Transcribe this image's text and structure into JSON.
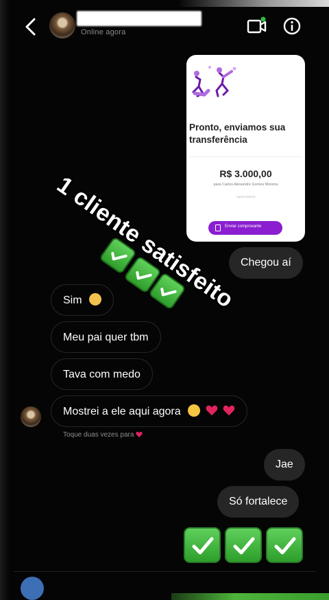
{
  "header": {
    "status": "Online agora",
    "icons": {
      "back": "chevron-left-icon",
      "video": "video-call-icon",
      "info": "info-icon"
    }
  },
  "card": {
    "title": "Pronto, enviamos sua transferência",
    "amount": "R$ 3.000,00",
    "recipient": "para Carlos Alexandre Gomes Moreira",
    "date": "Agora mesmo",
    "button_label": "Enviar comprovante",
    "accent": "#8a1ed0"
  },
  "sticker": {
    "text": "1 cliente satisfeito"
  },
  "messages": [
    {
      "id": "chegou",
      "side": "out",
      "text": "Chegou aí"
    },
    {
      "id": "sim",
      "side": "in",
      "text": "Sim",
      "emoji": "clapping-hands-icon"
    },
    {
      "id": "pai",
      "side": "in",
      "text": "Meu pai quer tbm"
    },
    {
      "id": "medo",
      "side": "in",
      "text": "Tava com medo"
    },
    {
      "id": "mostrei",
      "side": "in",
      "text": "Mostrei a ele aqui agora",
      "emoji": "laughing-face-icon heart-icon heart-icon"
    },
    {
      "id": "jae",
      "side": "out",
      "text": "Jae"
    },
    {
      "id": "fortalece",
      "side": "out",
      "text": "Só fortalece"
    }
  ],
  "hint": "Toque duas vezes para",
  "colors": {
    "background": "#050505",
    "bubble_out": "#262626",
    "check_green": "#3cb23a"
  }
}
